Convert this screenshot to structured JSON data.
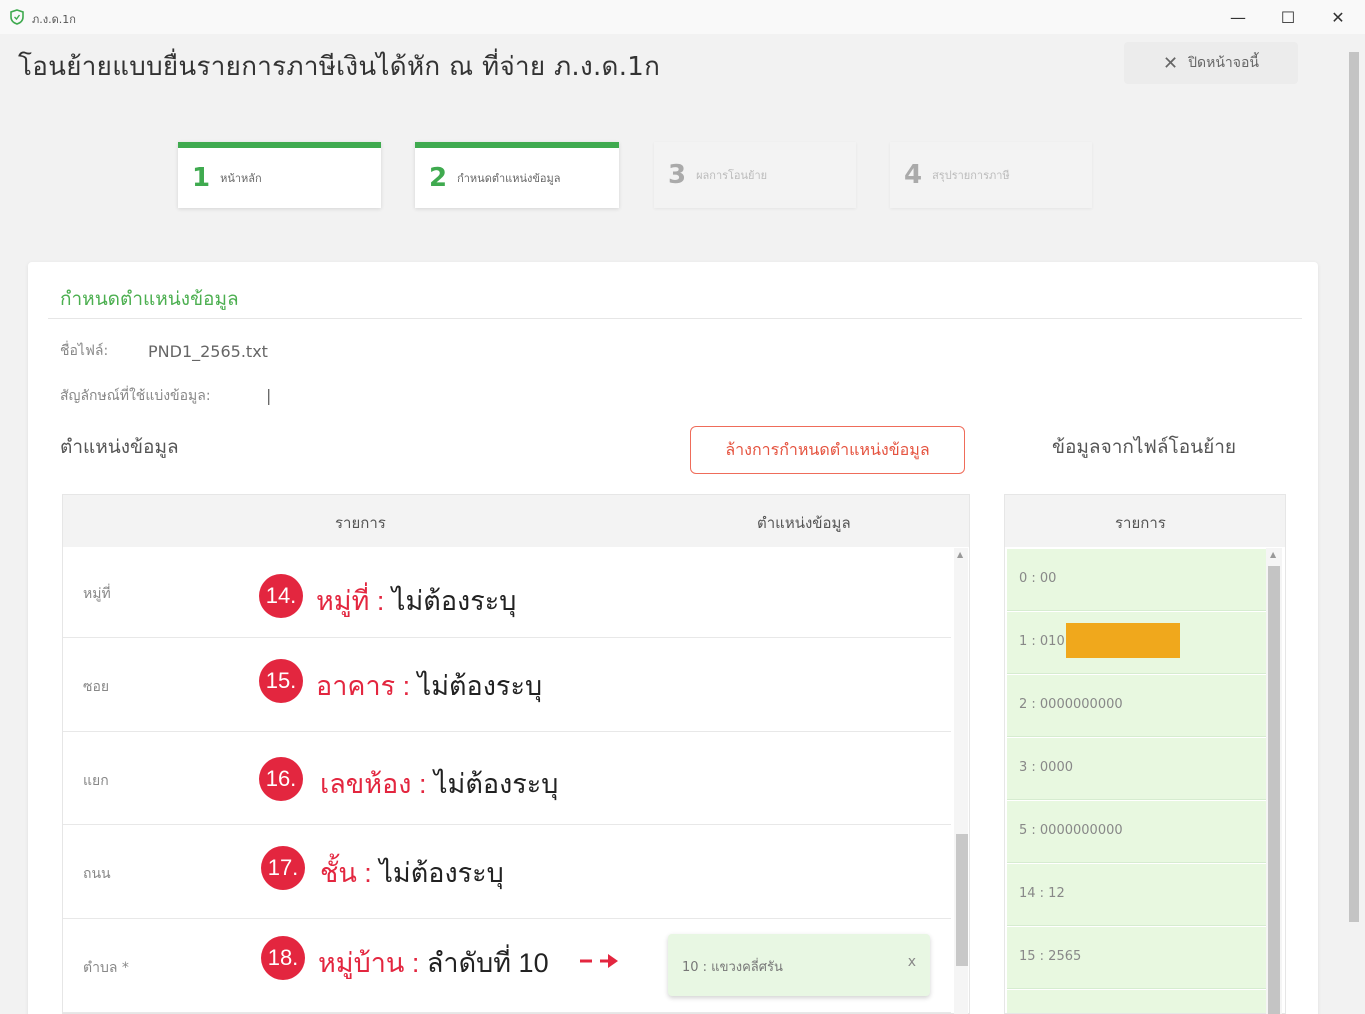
{
  "window": {
    "app_title": "ภ.ง.ด.1ก",
    "minimize": "—",
    "maximize": "☐",
    "close": "✕"
  },
  "header": {
    "title": "โอนย้ายแบบยื่นรายการภาษีเงินได้หัก ณ ที่จ่าย ภ.ง.ด.1ก",
    "close_page_label": "ปิดหน้าจอนี้"
  },
  "steps": [
    {
      "num": "1",
      "label": "หน้าหลัก"
    },
    {
      "num": "2",
      "label": "กำหนดตำแหน่งข้อมูล"
    },
    {
      "num": "3",
      "label": "ผลการโอนย้าย"
    },
    {
      "num": "4",
      "label": "สรุปรายการภาษี"
    }
  ],
  "section": {
    "title": "กำหนดตำแหน่งข้อมูล",
    "file_label": "ชื่อไฟล์:",
    "file_value": "PND1_2565.txt",
    "delimiter_label": "สัญลักษณ์ที่ใช้แบ่งข้อมูล:",
    "delimiter_value": "|",
    "positions_title": "ตำแหน่งข้อมูล",
    "reset_button": "ล้างการกำหนดตำแหน่งข้อมูล",
    "source_title": "ข้อมูลจากไฟล์โอนย้าย"
  },
  "table": {
    "col_item": "รายการ",
    "col_position": "ตำแหน่งข้อมูล",
    "rows": [
      {
        "name": "หมู่ที่"
      },
      {
        "name": "ซอย"
      },
      {
        "name": "แยก"
      },
      {
        "name": "ถนน"
      },
      {
        "name": "ตำบล *"
      }
    ],
    "chip_text": "10 : แขวงคลี่ศรัน",
    "chip_remove": "x"
  },
  "annotations": [
    {
      "num": "14.",
      "field": "หมู่ที่",
      "sep": " : ",
      "note": "ไม่ต้องระบุ"
    },
    {
      "num": "15.",
      "field": "อาคาร",
      "sep": " : ",
      "note": "ไม่ต้องระบุ"
    },
    {
      "num": "16.",
      "field": "เลขห้อง",
      "sep": " : ",
      "note": "ไม่ต้องระบุ"
    },
    {
      "num": "17.",
      "field": "ชั้น",
      "sep": " : ",
      "note": "ไม่ต้องระบุ"
    },
    {
      "num": "18.",
      "field": "หมู่บ้าน",
      "sep": " : ",
      "note": "ลำดับที่ 10"
    }
  ],
  "source_table": {
    "header": "รายการ",
    "items": [
      "0 : 00",
      "1 : 010",
      "2 : 0000000000",
      "3 : 0000",
      "5 : 0000000000",
      "14 : 12",
      "15 : 2565",
      ""
    ]
  },
  "colors": {
    "accent_green": "#3faa4f",
    "annotation_red": "#e3263f",
    "redaction": "#f0a81c"
  }
}
